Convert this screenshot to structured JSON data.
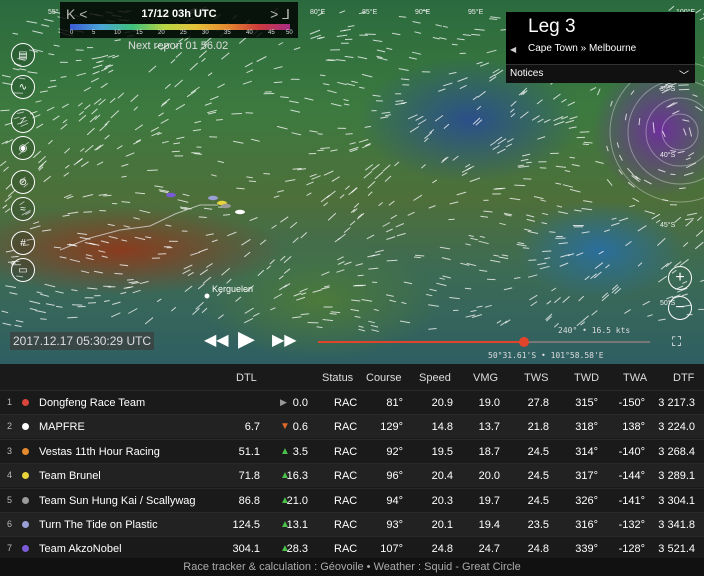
{
  "timeline": {
    "date": "17/12 03h UTC",
    "prev_label": "K <",
    "next_label": "> ⅃",
    "scale_labels": [
      "0",
      "5",
      "10",
      "15",
      "20",
      "25",
      "30",
      "35",
      "40",
      "45",
      "50"
    ],
    "next_report": "Next report 01 56.02"
  },
  "map": {
    "lon_labels": [
      "55°",
      "80°E",
      "85°E",
      "90°E",
      "95°E",
      "100°E"
    ],
    "lat_labels": [
      "35°S",
      "40°S",
      "45°S",
      "50°S"
    ],
    "place": "Kerguelen",
    "timestamp": "2017.12.17 05:30:29 UTC",
    "wind_readout": "240° • 16.5 kts",
    "pos_readout": "50°31.61'S • 101°58.58'E",
    "playback_fraction": 0.62
  },
  "leg": {
    "title": "Leg 3",
    "route": "Cape Town » Melbourne",
    "notices_label": "Notices"
  },
  "colors": {
    "accent": "#e0452b",
    "up": "#4cc04c",
    "down": "#e06a2a"
  },
  "left_icons": [
    "book-icon",
    "route-icon",
    "wind-particles-icon",
    "compass-icon",
    "satellite-icon",
    "waves-icon",
    "grid-icon",
    "ruler-icon"
  ],
  "table": {
    "headers": {
      "dtl": "DTL",
      "status": "Status",
      "course": "Course",
      "speed": "Speed",
      "vmg": "VMG",
      "tws": "TWS",
      "twd": "TWD",
      "twa": "TWA",
      "dtf": "DTF"
    },
    "rows": [
      {
        "rank": "1",
        "team": "Dongfeng Race Team",
        "color": "#d9453a",
        "dtl": "",
        "trend": "flat",
        "delta": "0.0",
        "status": "RAC",
        "course": "81°",
        "speed": "20.9",
        "vmg": "19.0",
        "tws": "27.8",
        "twd": "315°",
        "twa": "-150°",
        "dtf": "3 217.3"
      },
      {
        "rank": "2",
        "team": "MAPFRE",
        "color": "#ffffff",
        "dtl": "6.7",
        "trend": "down",
        "delta": "0.6",
        "status": "RAC",
        "course": "129°",
        "speed": "14.8",
        "vmg": "13.7",
        "tws": "21.8",
        "twd": "318°",
        "twa": "138°",
        "dtf": "3 224.0"
      },
      {
        "rank": "3",
        "team": "Vestas 11th Hour Racing",
        "color": "#e58a2f",
        "dtl": "51.1",
        "trend": "up",
        "delta": "3.5",
        "status": "RAC",
        "course": "92°",
        "speed": "19.5",
        "vmg": "18.7",
        "tws": "24.5",
        "twd": "314°",
        "twa": "-140°",
        "dtf": "3 268.4"
      },
      {
        "rank": "4",
        "team": "Team Brunel",
        "color": "#e6d43a",
        "dtl": "71.8",
        "trend": "up",
        "delta": "16.3",
        "status": "RAC",
        "course": "96°",
        "speed": "20.4",
        "vmg": "20.0",
        "tws": "24.5",
        "twd": "317°",
        "twa": "-144°",
        "dtf": "3 289.1"
      },
      {
        "rank": "5",
        "team": "Team Sun Hung Kai / Scallywag",
        "color": "#9a9a9a",
        "dtl": "86.8",
        "trend": "up",
        "delta": "21.0",
        "status": "RAC",
        "course": "94°",
        "speed": "20.3",
        "vmg": "19.7",
        "tws": "24.5",
        "twd": "326°",
        "twa": "-141°",
        "dtf": "3 304.1"
      },
      {
        "rank": "6",
        "team": "Turn The Tide on Plastic",
        "color": "#9aa0d6",
        "dtl": "124.5",
        "trend": "up",
        "delta": "13.1",
        "status": "RAC",
        "course": "93°",
        "speed": "20.1",
        "vmg": "19.4",
        "tws": "23.5",
        "twd": "316°",
        "twa": "-132°",
        "dtf": "3 341.8"
      },
      {
        "rank": "7",
        "team": "Team AkzoNobel",
        "color": "#7a5ad6",
        "dtl": "304.1",
        "trend": "up",
        "delta": "28.3",
        "status": "RAC",
        "course": "107°",
        "speed": "24.8",
        "vmg": "24.7",
        "tws": "24.8",
        "twd": "339°",
        "twa": "-128°",
        "dtf": "3 521.4"
      }
    ]
  },
  "footer": "Race tracker & calculation : Géovoile • Weather : Squid - Great Circle"
}
